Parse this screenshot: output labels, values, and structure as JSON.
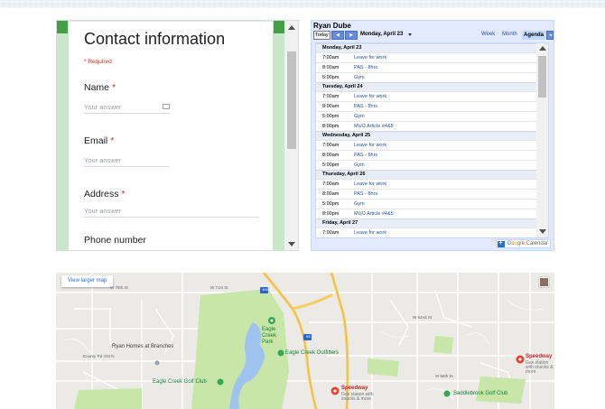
{
  "form": {
    "title": "Contact information",
    "required_note": "* Required",
    "questions": [
      {
        "label": "Name",
        "star": "*",
        "placeholder": "Your answer"
      },
      {
        "label": "Email",
        "star": "*",
        "placeholder": "Your answer"
      },
      {
        "label": "Address",
        "star": "*",
        "placeholder": "Your answer"
      },
      {
        "label": "Phone number",
        "star": ""
      }
    ],
    "icons": {
      "keyboard": "keyboard-icon",
      "scroll_up": "arrow-up-icon",
      "scroll_down": "arrow-down-icon"
    },
    "colors": {
      "accent": "#43a047",
      "background": "#c8e6c9",
      "required": "#d93025"
    }
  },
  "calendar": {
    "owner": "Ryan Dube",
    "today_label": "Today",
    "prev_label": "◀",
    "next_label": "▶",
    "current_date": "Monday, April 23",
    "views": {
      "week": "Week",
      "month": "Month",
      "agenda": "Agenda"
    },
    "footer": {
      "plus": "+",
      "google": [
        "G",
        "o",
        "o",
        "g",
        "l",
        "e"
      ],
      "calendar": "Calendar"
    },
    "days": [
      {
        "date": "Monday, April 23",
        "events": [
          {
            "time": "7:00am",
            "title": "Leave for work"
          },
          {
            "time": "8:00am",
            "title": "PAS - 8hrs"
          },
          {
            "time": "5:00pm",
            "title": "Gym"
          }
        ]
      },
      {
        "date": "Tuesday, April 24",
        "events": [
          {
            "time": "7:00am",
            "title": "Leave for work"
          },
          {
            "time": "8:00am",
            "title": "PAS - 8hrs"
          },
          {
            "time": "5:00pm",
            "title": "Gym"
          },
          {
            "time": "8:00pm",
            "title": "MUO Article #4&5"
          }
        ]
      },
      {
        "date": "Wednesday, April 25",
        "events": [
          {
            "time": "7:00am",
            "title": "Leave for work"
          },
          {
            "time": "8:00am",
            "title": "PAS - 8hrs"
          },
          {
            "time": "5:00pm",
            "title": "Gym"
          }
        ]
      },
      {
        "date": "Thursday, April 26",
        "events": [
          {
            "time": "7:00am",
            "title": "Leave for work"
          },
          {
            "time": "8:00am",
            "title": "PAS - 8hrs"
          },
          {
            "time": "5:00pm",
            "title": "Gym"
          },
          {
            "time": "8:00pm",
            "title": "MUO Article #4&5"
          }
        ]
      },
      {
        "date": "Friday, April 27",
        "events": [
          {
            "time": "7:00am",
            "title": "Leave for work"
          }
        ]
      }
    ],
    "colors": {
      "frame": "#e3e9ff",
      "nav": "#668cd9",
      "event_link": "#2952a3"
    }
  },
  "map": {
    "view_larger": "View larger map",
    "labels": {
      "ryan_homes": "Ryan Homes at Branches",
      "eagle_creek_park": "Eagle Creek Park",
      "eagle_creek_outfitters": "Eagle Creek Outfitters",
      "eagle_creek_golf": "Eagle Creek Golf Club",
      "speedway_1": "Speedway",
      "speedway_1_sub": "Gas station with snacks & more",
      "speedway_2": "Speedway",
      "speedway_2_sub": "Gas station with snacks & more",
      "saddlebrook": "Saddlebrook Golf Club",
      "road_w56": "W 56th St",
      "road_w71": "W 71st St",
      "road_w62": "W 62nd St",
      "road_w79": "W 79th St",
      "road_cr200": "County Rd 200 N",
      "shield_465": "465",
      "shield_65": "65"
    },
    "colors": {
      "land": "#eceae6",
      "park": "#c8e6a8",
      "water": "#9ec3ee",
      "highway": "#f6cd5f",
      "poi": "#ea4335"
    }
  }
}
